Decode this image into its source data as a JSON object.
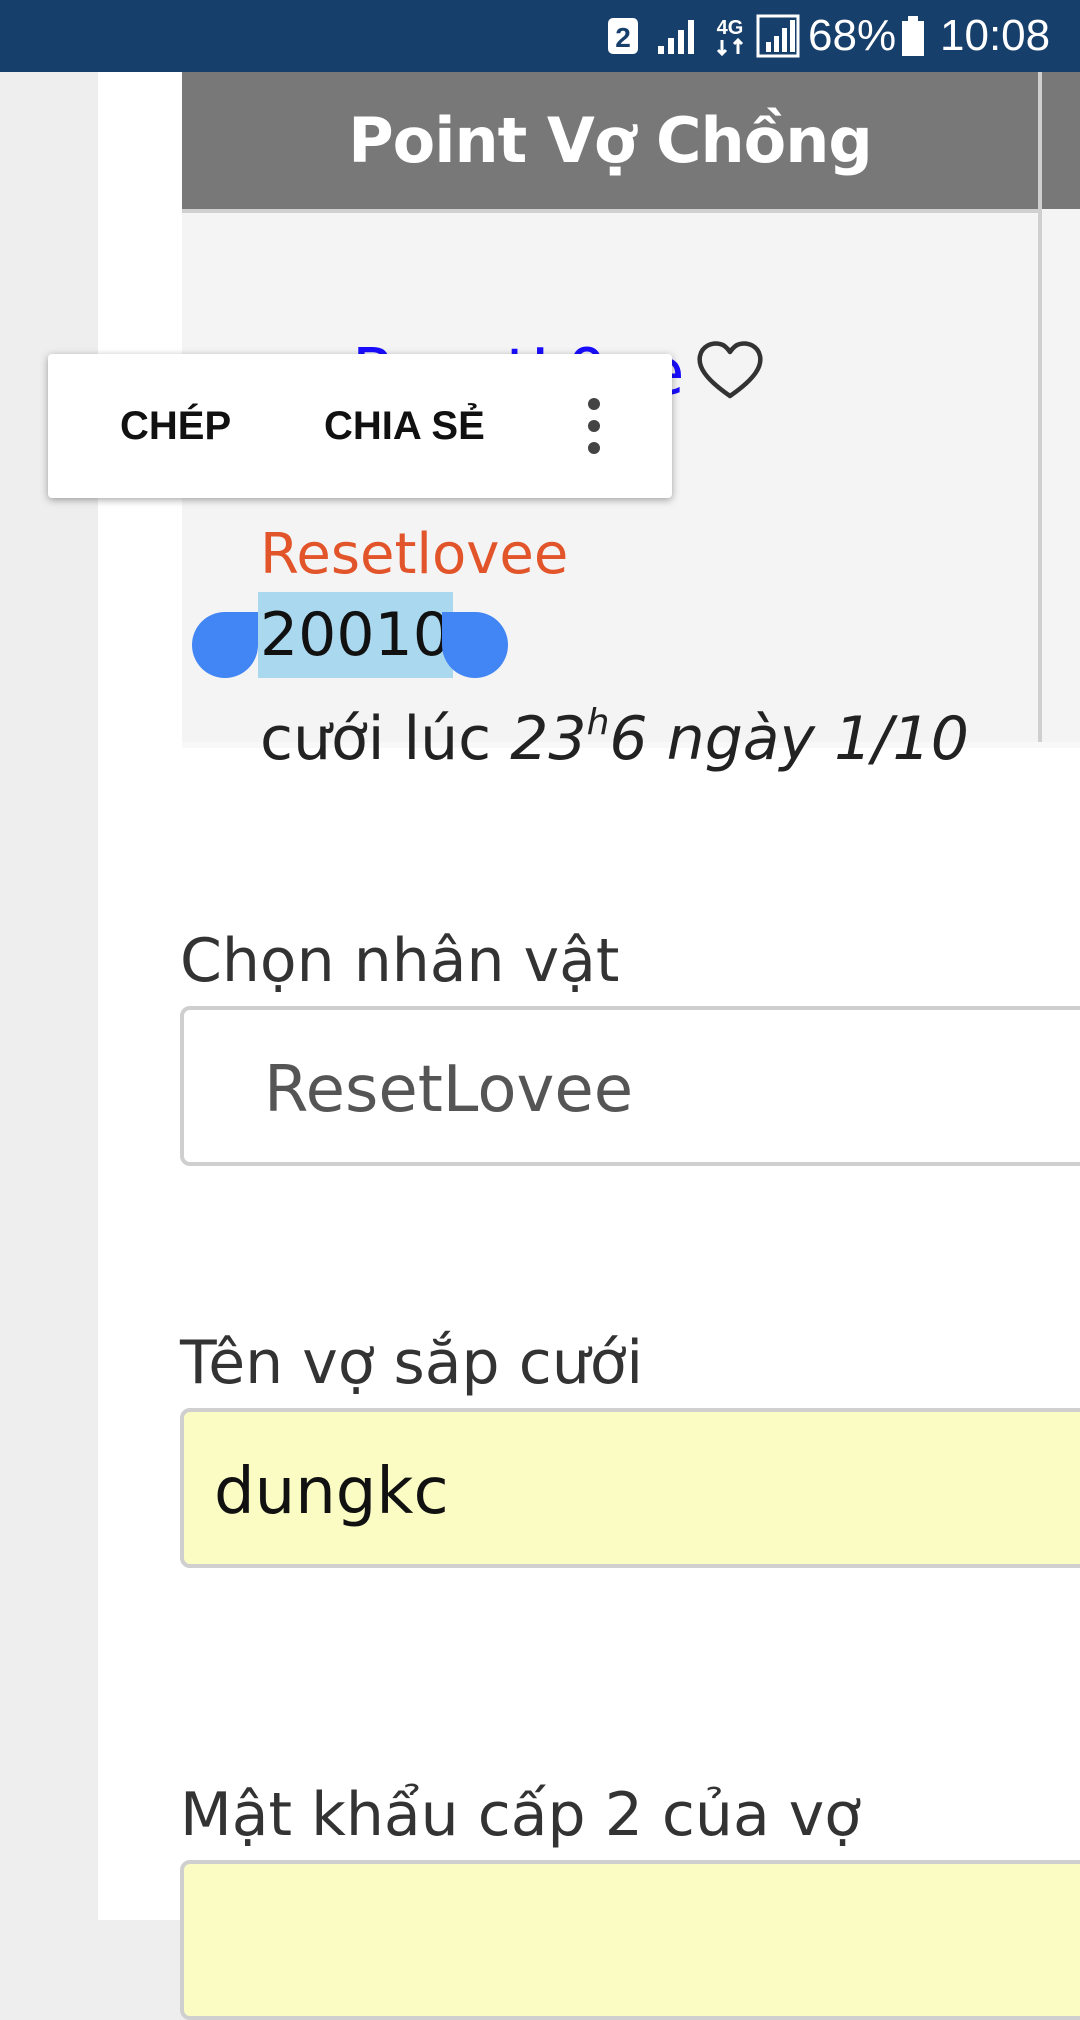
{
  "status_bar": {
    "sim_badge": "2",
    "network_label": "4G",
    "battery_percent": "68%",
    "time": "10:08",
    "background_color": "#173f6b"
  },
  "card": {
    "header_title": "Point Vợ Chồng",
    "link_text": "ResetL0ve",
    "orange_name": "Resetlovee",
    "selected_number": "20010",
    "married_prefix": "cưới lúc ",
    "married_hour": "23",
    "married_hour_unit": "h",
    "married_rest": "6 ngày 1/10",
    "header_color": "#787878",
    "link_color": "#1a0dff",
    "name_color": "#e2542a",
    "selection_color": "#aad8ef"
  },
  "context_menu": {
    "copy_label": "CHÉP",
    "share_label": "CHIA SẺ",
    "more_icon": "more-vertical-icon"
  },
  "form": {
    "character_label": "Chọn nhân vật",
    "character_value": "ResetLovee",
    "wife_name_label": "Tên vợ sắp cưới",
    "wife_name_value": "dungkc",
    "wife_password_label": "Mật khẩu cấp 2 của vợ",
    "wife_password_value": "",
    "input_fill_color": "#fafcc4"
  }
}
